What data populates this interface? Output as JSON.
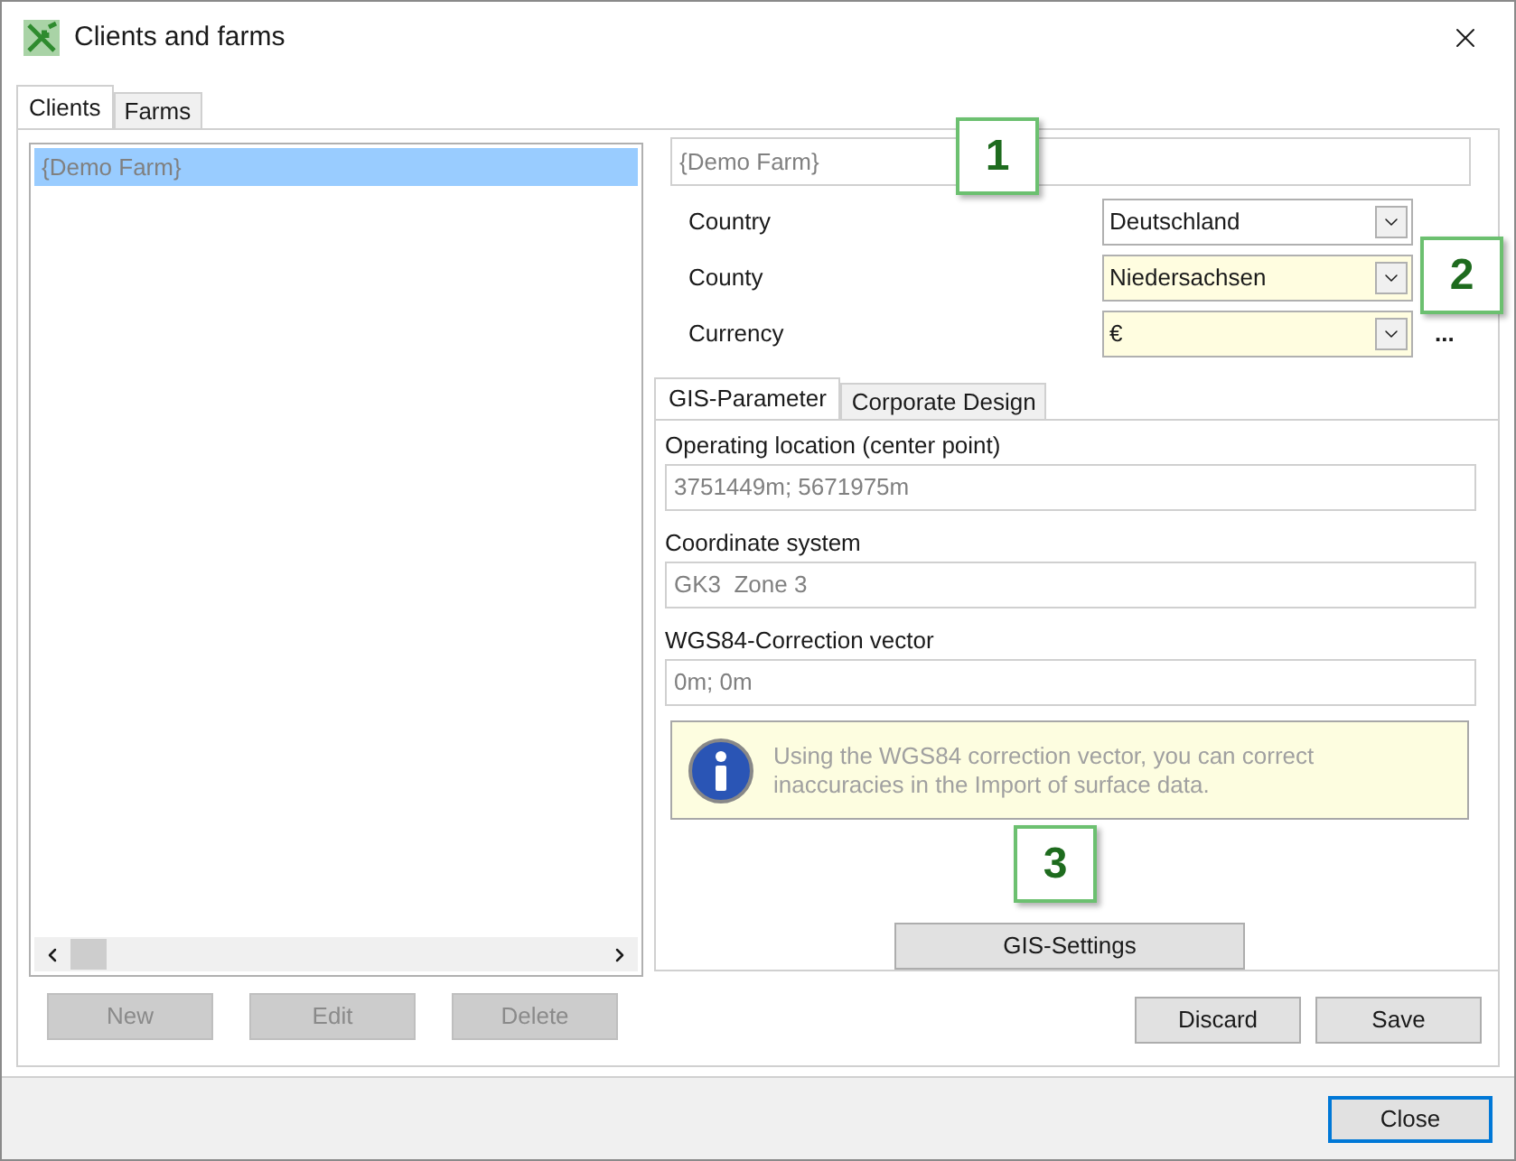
{
  "window": {
    "title": "Clients and farms"
  },
  "tabs": [
    {
      "label": "Clients",
      "selected": true
    },
    {
      "label": "Farms",
      "selected": false
    }
  ],
  "client_list": {
    "items": [
      {
        "label": "{Demo Farm}",
        "selected": true
      }
    ]
  },
  "list_buttons": [
    {
      "label": "New",
      "disabled": true
    },
    {
      "label": "Edit",
      "disabled": true
    },
    {
      "label": "Delete",
      "disabled": true
    }
  ],
  "farm_name": {
    "value": "{Demo Farm}"
  },
  "form_rows": [
    {
      "label": "Country",
      "value": "Deutschland",
      "highlighted": false
    },
    {
      "label": "County",
      "value": "Niedersachsen",
      "highlighted": true
    },
    {
      "label": "Currency",
      "value": "€",
      "highlighted": true
    }
  ],
  "more_button": "...",
  "inner_tabs": [
    {
      "label": "GIS-Parameter",
      "selected": true
    },
    {
      "label": "Corporate Design",
      "selected": false
    }
  ],
  "gis_fields": [
    {
      "label": "Operating location (center point)",
      "value": "3751449m; 5671975m"
    },
    {
      "label": "Coordinate system",
      "value": "GK3  Zone 3"
    },
    {
      "label": "WGS84-Correction vector",
      "value": "0m; 0m"
    }
  ],
  "info": "Using the WGS84 correction vector, you can correct inaccuracies in the Import of surface data.",
  "gis_button": "GIS-Settings",
  "action_buttons": [
    "Discard",
    "Save"
  ],
  "close_button": "Close",
  "callouts": [
    "1",
    "2",
    "3"
  ]
}
